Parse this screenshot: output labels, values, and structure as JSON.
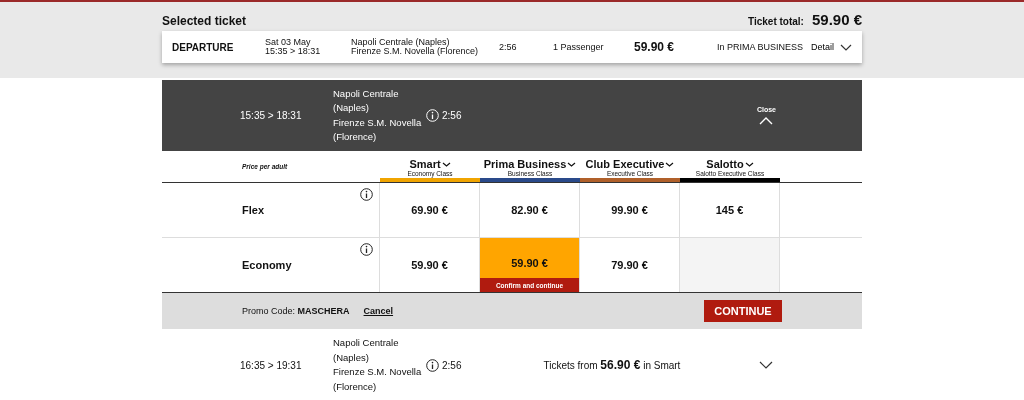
{
  "summary": {
    "title": "Selected ticket",
    "total_label": "Ticket total:",
    "total": "59.90 €",
    "ticket": {
      "direction": "DEPARTURE",
      "date": "Sat 03 May",
      "times": "15:35 > 18:31",
      "from": "Napoli Centrale (Naples)",
      "to": "Firenze S.M. Novella (Florence)",
      "duration": "2:56",
      "passengers": "1 Passenger",
      "price": "59.90 €",
      "class": "In PRIMA BUSINESS",
      "detail": "Detail",
      "expanded": false
    }
  },
  "selected_train": {
    "times": "15:35 > 18:31",
    "from_lines": [
      "Napoli Centrale",
      "(Naples)"
    ],
    "to_lines": [
      "Firenze S.M. Novella",
      "(Florence)"
    ],
    "duration": "2:56",
    "close": "Close"
  },
  "fare_table": {
    "price_label": "Price per adult",
    "classes": [
      {
        "name": "Smart",
        "subtitle": "Economy Class",
        "color": "#f0a400"
      },
      {
        "name": "Prima Business",
        "subtitle": "Business Class",
        "color": "#2a4a8a"
      },
      {
        "name": "Club Executive",
        "subtitle": "Executive Class",
        "color": "#b0602a"
      },
      {
        "name": "Salotto",
        "subtitle": "Salotto Executive Class",
        "color": "#000000"
      }
    ],
    "fares": [
      {
        "name": "Flex",
        "cells": [
          {
            "kind": "price",
            "price": "69.90 €",
            "selected": false
          },
          {
            "kind": "price",
            "price": "82.90 €",
            "selected": false
          },
          {
            "kind": "price",
            "price": "99.90 €",
            "selected": false
          },
          {
            "kind": "price",
            "price": "145 €",
            "selected": false
          }
        ]
      },
      {
        "name": "Economy",
        "cells": [
          {
            "kind": "price",
            "price": "59.90 €",
            "selected": false
          },
          {
            "kind": "price",
            "price": "59.90 €",
            "selected": true,
            "action": "Confirm and continue"
          },
          {
            "kind": "price",
            "price": "79.90 €",
            "selected": false
          },
          {
            "kind": "unavailable"
          }
        ]
      }
    ]
  },
  "promo": {
    "label": "Promo Code:",
    "code": "MASCHERA",
    "cancel": "Cancel",
    "continue": "CONTINUE"
  },
  "other_train": {
    "times": "16:35 > 19:31",
    "from_lines": [
      "Napoli Centrale",
      "(Naples)"
    ],
    "to_lines": [
      "Firenze S.M. Novella",
      "(Florence)"
    ],
    "duration": "2:56",
    "from_label": "Tickets from",
    "price": "56.90 €",
    "class_label": "in Smart",
    "expanded": false
  }
}
